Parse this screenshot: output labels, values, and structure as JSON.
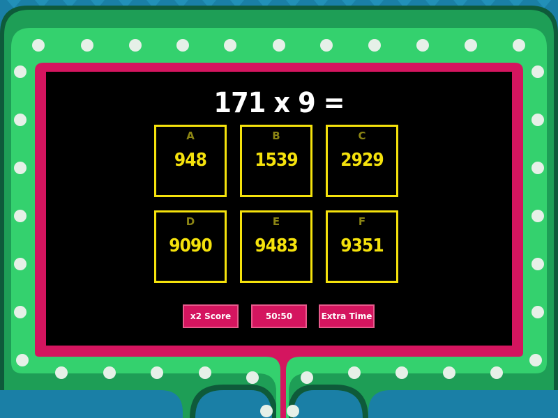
{
  "question": "171 x 9 =",
  "answers": [
    {
      "letter": "A",
      "value": "948"
    },
    {
      "letter": "B",
      "value": "1539"
    },
    {
      "letter": "C",
      "value": "2929"
    },
    {
      "letter": "D",
      "value": "9090"
    },
    {
      "letter": "E",
      "value": "9483"
    },
    {
      "letter": "F",
      "value": "9351"
    }
  ],
  "powerups": {
    "double_score": "x2 Score",
    "fifty_fifty": "50:50",
    "extra_time": "Extra Time"
  },
  "colors": {
    "background": "#1a7fa6",
    "frame_outer": "#1e9e56",
    "frame_inner": "#34d16e",
    "bulbs": "#e6f0e8",
    "screen_border": "#d4155f",
    "screen": "#000000",
    "tile_border": "#f5e20c",
    "letter": "#8c8514",
    "powerup": "#d4155f"
  }
}
